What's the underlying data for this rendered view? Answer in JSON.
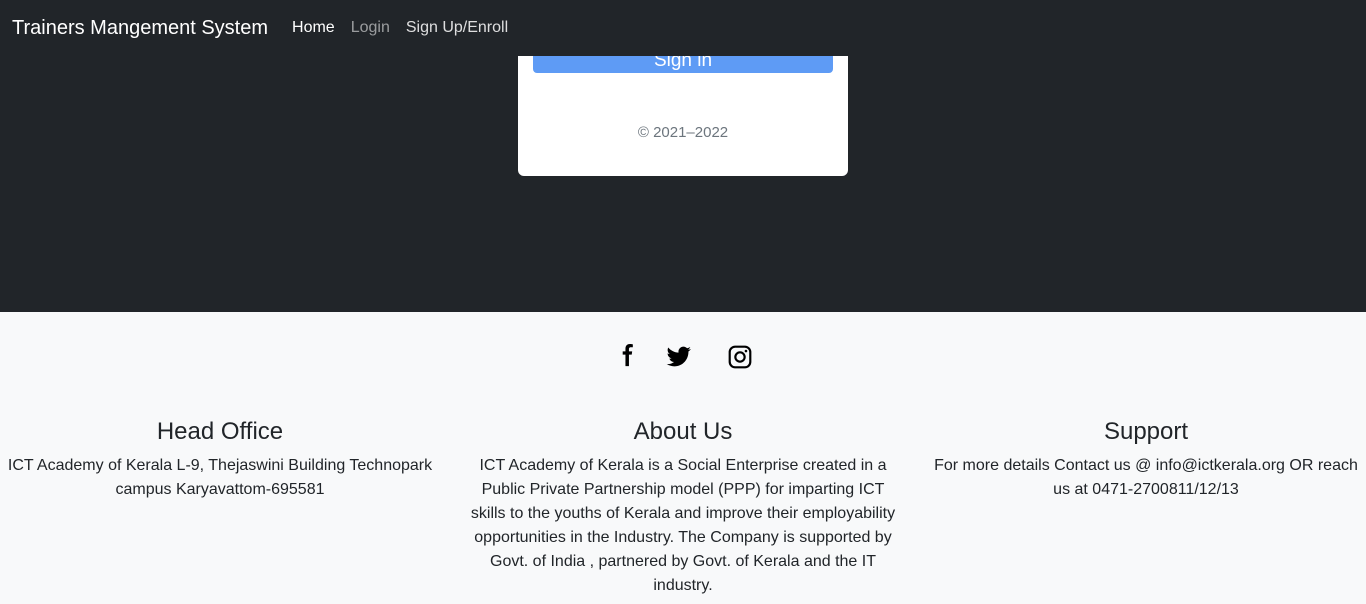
{
  "navbar": {
    "brand": "Trainers Mangement System",
    "links": [
      {
        "label": "Home"
      },
      {
        "label": "Login"
      },
      {
        "label": "Sign Up/Enroll"
      }
    ]
  },
  "card": {
    "signin_label": "Sign in",
    "copyright": "© 2021–2022"
  },
  "footer": {
    "social": [
      "facebook-icon",
      "twitter-icon",
      "instagram-icon"
    ],
    "head_office": {
      "title": "Head Office",
      "text": "ICT Academy of Kerala L-9, Thejaswini Building Technopark campus Karyavattom-695581"
    },
    "about": {
      "title": "About Us",
      "text": "ICT Academy of Kerala is a Social Enterprise created in a Public Private Partnership model (PPP) for imparting ICT skills to the youths of Kerala and improve their employability opportunities in the Industry. The Company is supported by Govt. of India , partnered by Govt. of Kerala and the IT industry."
    },
    "support": {
      "title": "Support",
      "text": "For more details Contact us @ info@ictkerala.org OR reach us at 0471-2700811/12/13"
    }
  },
  "colors": {
    "dark": "#212529",
    "light": "#f8f9fa",
    "primary_button": "#5e9bf5"
  }
}
